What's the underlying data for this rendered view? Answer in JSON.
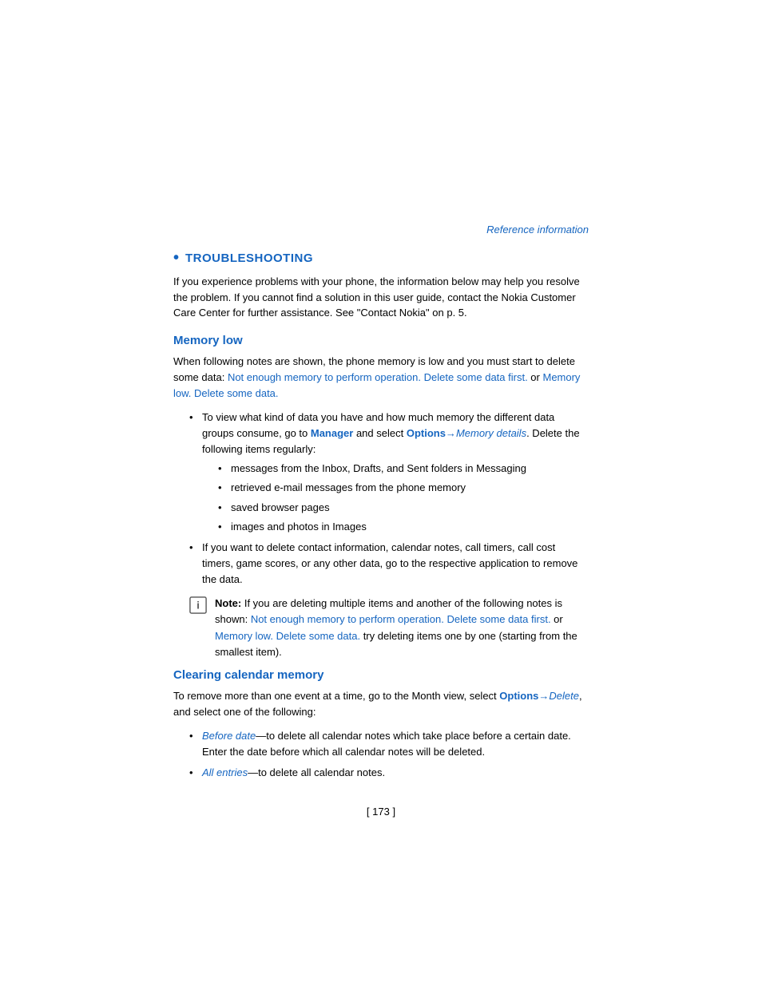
{
  "reference": {
    "label": "Reference information"
  },
  "troubleshooting": {
    "bullet": "•",
    "title": "TROUBLESHOOTING",
    "intro": "If you experience problems with your phone, the information below may help you resolve the problem. If you cannot find a solution in this user guide, contact the Nokia Customer Care Center for further assistance. See \"Contact Nokia\" on p. 5."
  },
  "memory_low": {
    "title": "Memory low",
    "description_start": "When following notes are shown, the phone memory is low and you must start to delete some data: ",
    "link1": "Not enough memory to perform operation. Delete some data first.",
    "link1_separator": " or ",
    "link2": "Memory low. Delete some data.",
    "bullet1": {
      "text_start": "To view what kind of data you have and how much memory the different data groups consume, go to ",
      "manager": "Manager",
      "text_mid": " and select ",
      "options": "Options→",
      "memory_details": "Memory details",
      "text_end": ". Delete the following items regularly:",
      "sub_items": [
        "messages from the Inbox, Drafts, and Sent folders in Messaging",
        "retrieved e-mail messages from the phone memory",
        "saved browser pages",
        "images and photos in Images"
      ]
    },
    "bullet2": "If you want to delete contact information, calendar notes, call timers, call cost timers, game scores, or any other data, go to the respective application to remove the data.",
    "note": {
      "bold_start": "Note:",
      "text_start": " If you are deleting multiple items and another of the following notes is shown: ",
      "link1": "Not enough memory to perform operation. Delete some data first.",
      "text_mid": " or ",
      "link2": "Memory low. Delete some data.",
      "text_end": " try deleting items one by one (starting from the smallest item)."
    }
  },
  "clearing_calendar": {
    "title": "Clearing calendar memory",
    "description_start": "To remove more than one event at a time, go to the Month view, select ",
    "options_link": "Options→",
    "delete_link": "Delete",
    "description_end": ", and select one of the following:",
    "bullet1": {
      "link": "Before date",
      "text": "—to delete all calendar notes which take place before a certain date. Enter the date before which all calendar notes will be deleted."
    },
    "bullet2": {
      "link": "All entries",
      "text": "—to delete all calendar notes."
    }
  },
  "page_number": "[ 173 ]"
}
